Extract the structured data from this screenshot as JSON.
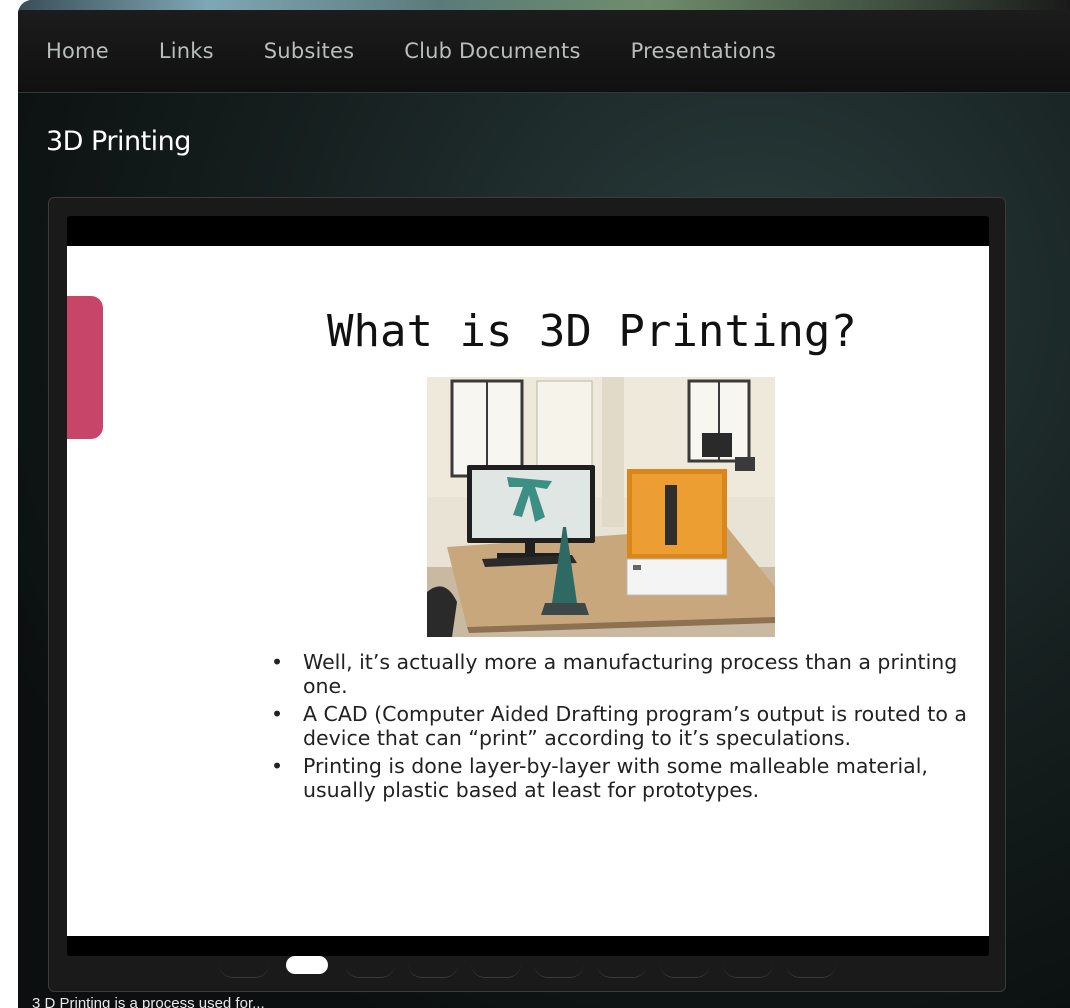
{
  "nav": {
    "items": [
      {
        "label": "Home"
      },
      {
        "label": "Links"
      },
      {
        "label": "Subsites"
      },
      {
        "label": "Club Documents"
      },
      {
        "label": "Presentations"
      }
    ]
  },
  "page": {
    "title": "3D Printing"
  },
  "slide": {
    "title": "What is 3D Printing?",
    "image_icon": "3d-printer-photo",
    "bullets": [
      {
        "dot": "•",
        "text": "Well, it’s actually more a manufacturing process than a printing one."
      },
      {
        "dot": "•",
        "text": "A CAD (Computer Aided Drafting program’s output is routed to a device that can “print” according to it’s speculations."
      },
      {
        "dot": "•",
        "text": "Printing is done layer-by-layer with some malleable material, usually plastic based at least for prototypes."
      }
    ],
    "accent_color": "#c8456a"
  },
  "pager": {
    "total": 10,
    "active_index": 1
  },
  "caption": {
    "text": "3 D Printing is a process used for..."
  }
}
